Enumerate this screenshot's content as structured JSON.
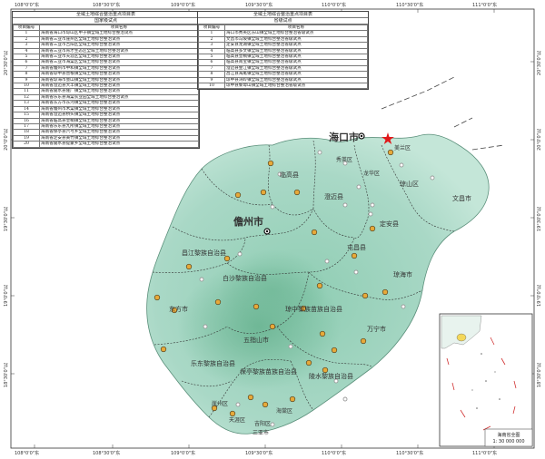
{
  "table_left": {
    "title": "全域土地综合整治重点项目表",
    "subtitle": "国家级试点",
    "col_num": "项目编号",
    "col_name": "项目名称",
    "rows": [
      {
        "n": "1",
        "t": "海南省海口市琼山区甲子镇全域土地综合整治试点"
      },
      {
        "n": "2",
        "t": "海南省三亚市崖州区全域土地综合整治试点"
      },
      {
        "n": "3",
        "t": "海南省三亚市吉阳区全域土地综合整治试点"
      },
      {
        "n": "4",
        "t": "海南省三亚市育才生态区全域土地综合整治试点"
      },
      {
        "n": "5",
        "t": "海南省三亚市天涯区全域土地综合整治试点"
      },
      {
        "n": "6",
        "t": "海南省三亚市海棠区全域土地综合整治试点"
      },
      {
        "n": "7",
        "t": "海南省儋州市中和镇全域土地综合整治试点"
      },
      {
        "n": "8",
        "t": "海南省琼中县营根镇全域土地综合整治试点"
      },
      {
        "n": "9",
        "t": "海南省琼海市会山镇全域土地综合整治试点"
      },
      {
        "n": "10",
        "t": "海南省澄迈县大丰镇全域土地综合整治试点"
      },
      {
        "n": "11",
        "t": "海南省陵水县隆广镇全域土地综合整治试点"
      },
      {
        "n": "12",
        "t": "海南省乐东县海棠农业园全域土地综合整治试点"
      },
      {
        "n": "13",
        "t": "海南省东方市东河镇全域土地综合整治试点"
      },
      {
        "n": "14",
        "t": "海南省儋州市木棠镇全域土地综合整治试点"
      },
      {
        "n": "15",
        "t": "海南省澄迈县桥头镇全域土地综合整治试点"
      },
      {
        "n": "16",
        "t": "海南省临高县皇桐镇全域土地综合整治试点"
      },
      {
        "n": "17",
        "t": "海南省乐东县九所镇全域土地综合整治试点"
      },
      {
        "n": "18",
        "t": "海南省保亭县六弓乡全域土地综合整治试点"
      },
      {
        "n": "19",
        "t": "海南省定安县黄竹镇全域土地综合整治试点"
      },
      {
        "n": "20",
        "t": "海南省陵水县提蒙乡全域土地综合整治试点"
      }
    ]
  },
  "table_right": {
    "title": "全域土地综合整治重点项目表",
    "subtitle": "省级试点",
    "col_num": "项目编号",
    "col_name": "项目名称",
    "rows": [
      {
        "n": "1",
        "t": "海口市秀英区东山镇全域土地综合整治省级试点"
      },
      {
        "n": "2",
        "t": "文昌市冯坡镇全域土地综合整治省级试点"
      },
      {
        "n": "3",
        "t": "定安县龙湖镇全域土地综合整治省级试点"
      },
      {
        "n": "4",
        "t": "临高县多文镇全域土地综合整治省级试点"
      },
      {
        "n": "5",
        "t": "临高县皇桐镇全域土地综合整治省级试点"
      },
      {
        "n": "6",
        "t": "临高县南宝镇全域土地综合整治省级试点"
      },
      {
        "n": "7",
        "t": "澄迈县金江镇全域土地综合整治省级试点"
      },
      {
        "n": "8",
        "t": "昌江县海尾镇全域土地综合整治省级试点"
      },
      {
        "n": "9",
        "t": "琼中县湾岭镇全域土地综合整治省级试点"
      },
      {
        "n": "10",
        "t": "琼中县黎母山镇全域土地综合整治省级试点"
      }
    ]
  },
  "coords": {
    "top": [
      "108°0'0\"东",
      "108°30'0\"东",
      "109°0'0\"东",
      "109°30'0\"东",
      "110°0'0\"东",
      "110°30'0\"东",
      "111°0'0\"东"
    ],
    "bottom": [
      "108°0'0\"东",
      "108°30'0\"东",
      "109°0'0\"东",
      "109°30'0\"东",
      "110°0'0\"东",
      "110°30'0\"东",
      "111°0'0\"东"
    ],
    "left": [
      "20°30'0\"北",
      "20°0'0\"北",
      "19°30'0\"北",
      "19°0'0\"北",
      "18°30'0\"北"
    ],
    "right": [
      "20°30'0\"北",
      "20°0'0\"北",
      "19°30'0\"北",
      "19°0'0\"北",
      "18°30'0\"北"
    ]
  },
  "places": {
    "haikou": "海口市",
    "danzhou": "儋州市",
    "lingao": "临高县",
    "chengmai": "澄迈县",
    "xiuying": "秀英区",
    "longhua": "龙华区",
    "meilan": "美兰区",
    "qiongshan": "琼山区",
    "wenchang": "文昌市",
    "dingan": "定安县",
    "tunchang": "屯昌县",
    "qionghai": "琼海市",
    "changjiang": "昌江黎族自治县",
    "baisha": "白沙黎族自治县",
    "dongfang": "东方市",
    "qiongzhong": "琼中黎族苗族自治县",
    "wuzhishan": "五指山市",
    "wanning": "万宁市",
    "ledong": "乐东黎族自治县",
    "baoting": "保亭黎族苗族自治县",
    "lingshui": "陵水黎族自治县",
    "yazhou": "崖州区",
    "tianya": "天涯区",
    "jiyang": "吉阳区",
    "haitang": "海棠区",
    "sanya": "三亚市"
  },
  "inset": {
    "title": "海南省全图",
    "scale": "1: 30 000 000"
  },
  "colors": {
    "land": "#a7d6c3",
    "sea": "#ffffff",
    "national_point": "#e6a93a",
    "provincial_point": "#9a9a9a",
    "capital_star": "#e0191b"
  }
}
